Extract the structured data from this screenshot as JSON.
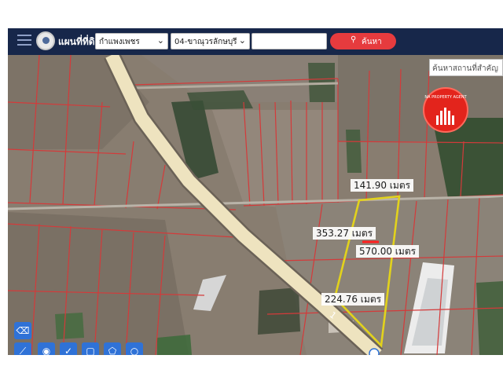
{
  "app": {
    "title": "แผนที่ที่ดิน"
  },
  "toolbar": {
    "province_value": "กำแพงเพชร",
    "district_value": "04-ขาณุวรลักษบุรี",
    "search_value": "",
    "search_button_label": "ค้นหา"
  },
  "place_search": {
    "placeholder": "ค้นหาสถานที่สำคัญ"
  },
  "badge": {
    "text": "NA PROPERTY AGENT"
  },
  "road": {
    "number_label": "1"
  },
  "measurements": {
    "north": "141.90 เมตร",
    "west": "353.27 เมตร",
    "east": "570.00 เมตร",
    "south": "224.76 เมตร"
  },
  "icons": {
    "menu": "hamburger-menu-icon",
    "search": "magnifier-icon",
    "eraser": "eraser-icon",
    "ruler": "ruler-icon",
    "pin": "location-pin-icon",
    "check": "check-icon",
    "area": "area-select-icon",
    "circle": "circle-draw-icon"
  },
  "colors": {
    "toolbar_bg": "#17274a",
    "search_button": "#e63b3e",
    "parcel_line": "#d43a3a",
    "plot_outline": "#e2d21c",
    "road": "#e9dfb8",
    "badge": "#e3241c",
    "tool_button": "#2f72d7"
  }
}
